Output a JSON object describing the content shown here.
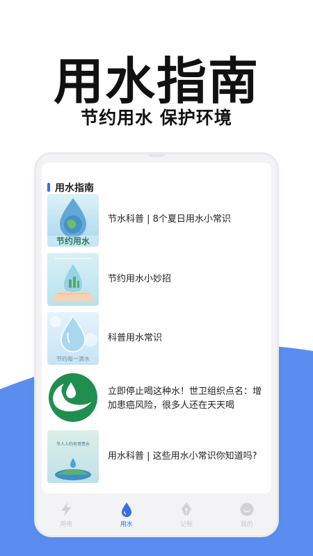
{
  "hero": {
    "title": "用水指南",
    "subtitle": "节约用水 保护环境"
  },
  "colors": {
    "accent": "#3b6fe0",
    "wave": "#5b8df0",
    "tab_inactive": "#c8c8cc"
  },
  "section": {
    "title": "用水指南"
  },
  "articles": [
    {
      "title": "节水科普 | 8个夏日用水小常识",
      "thumb_caption": "节约用水",
      "thumb_icon": "earth-water-drop-icon"
    },
    {
      "title": "节约用水小妙招",
      "thumb_caption": "",
      "thumb_icon": "hands-water-drop-icon"
    },
    {
      "title": "科普用水常识",
      "thumb_caption": "节约每一滴水",
      "thumb_icon": "water-drop-icon"
    },
    {
      "title": "立即停止喝这种水！世卫组织点名：增加患癌风险，很多人还在天天喝",
      "thumb_caption": "",
      "thumb_icon": "green-water-logo-icon"
    },
    {
      "title": "用水科普 | 这些用水小常识你知道吗?",
      "thumb_caption": "节人人约有用责水",
      "thumb_icon": "globe-water-icon"
    }
  ],
  "tabs": [
    {
      "label": "用电",
      "icon": "lightning-icon",
      "active": false
    },
    {
      "label": "用水",
      "icon": "water-drop-icon",
      "active": true
    },
    {
      "label": "记账",
      "icon": "pen-nib-icon",
      "active": false
    },
    {
      "label": "我的",
      "icon": "smiley-face-icon",
      "active": false
    }
  ]
}
